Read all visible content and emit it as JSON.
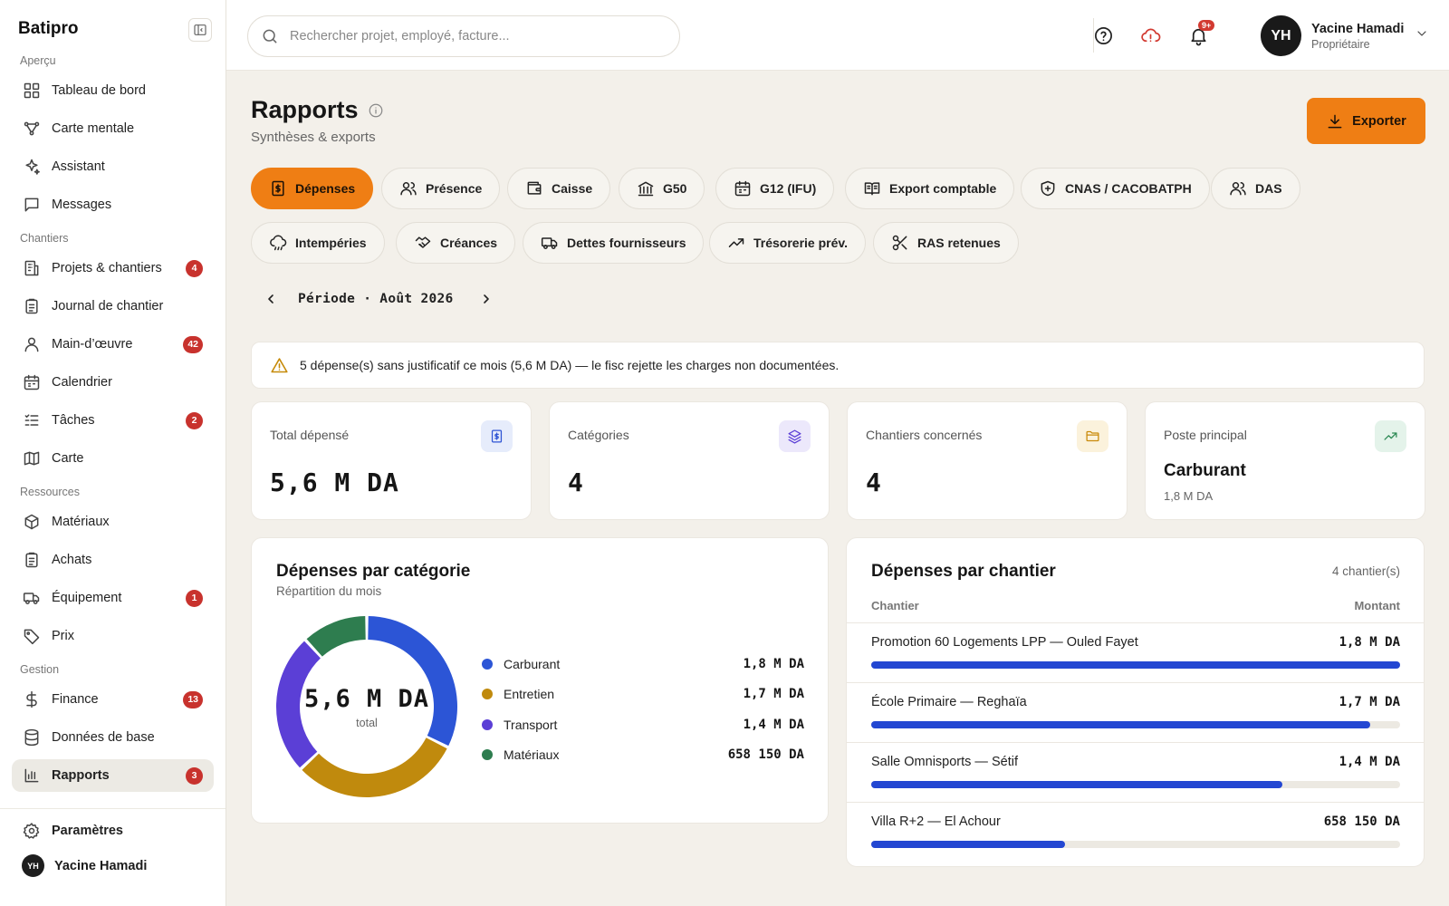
{
  "app": {
    "brand": "Batipro"
  },
  "sidebar": {
    "sections": [
      {
        "title": "Aperçu",
        "items": [
          {
            "label": "Tableau de bord",
            "icon": "dashboard-icon"
          },
          {
            "label": "Carte mentale",
            "icon": "mindmap-icon"
          },
          {
            "label": "Assistant",
            "icon": "sparkles-icon"
          },
          {
            "label": "Messages",
            "icon": "message-icon"
          }
        ]
      },
      {
        "title": "Chantiers",
        "items": [
          {
            "label": "Projets & chantiers",
            "icon": "building-icon",
            "badge": "4"
          },
          {
            "label": "Journal de chantier",
            "icon": "clipboard-icon"
          },
          {
            "label": "Main-d’œuvre",
            "icon": "user-icon",
            "badge": "42"
          },
          {
            "label": "Calendrier",
            "icon": "calendar-icon"
          },
          {
            "label": "Tâches",
            "icon": "tasks-icon",
            "badge": "2"
          },
          {
            "label": "Carte",
            "icon": "map-icon"
          }
        ]
      },
      {
        "title": "Ressources",
        "items": [
          {
            "label": "Matériaux",
            "icon": "package-icon"
          },
          {
            "label": "Achats",
            "icon": "clipboard-icon"
          },
          {
            "label": "Équipement",
            "icon": "truck-icon",
            "badge": "1"
          },
          {
            "label": "Prix",
            "icon": "tag-icon"
          }
        ]
      },
      {
        "title": "Gestion",
        "items": [
          {
            "label": "Finance",
            "icon": "dollar-icon",
            "badge": "13"
          },
          {
            "label": "Données de base",
            "icon": "database-icon"
          },
          {
            "label": "Rapports",
            "icon": "bar-chart-icon",
            "badge": "3",
            "active": true
          }
        ]
      }
    ],
    "settings_label": "Paramètres",
    "user": {
      "initials": "YH",
      "name": "Yacine Hamadi"
    }
  },
  "topbar": {
    "search_placeholder": "Rechercher projet, employé, facture...",
    "notif_badge": "9+",
    "user": {
      "initials": "YH",
      "name": "Yacine Hamadi",
      "role": "Propriétaire"
    }
  },
  "page": {
    "title": "Rapports",
    "subtitle": "Synthèses & exports",
    "export_label": "Exporter",
    "tabs": [
      {
        "label": "Dépenses",
        "icon": "receipt-icon",
        "active": true
      },
      {
        "label": "Présence",
        "icon": "users-icon"
      },
      {
        "label": "Caisse",
        "icon": "wallet-icon"
      },
      {
        "label": "G50",
        "icon": "bank-icon"
      },
      {
        "label": "G12 (IFU)",
        "icon": "calendar-icon"
      },
      {
        "label": "Export comptable",
        "icon": "book-icon"
      },
      {
        "label": "CNAS / CACOBATPH",
        "icon": "shield-icon"
      },
      {
        "label": "DAS",
        "icon": "users-icon"
      },
      {
        "label": "Intempéries",
        "icon": "cloud-rain-icon"
      },
      {
        "label": "Créances",
        "icon": "handshake-icon"
      },
      {
        "label": "Dettes fournisseurs",
        "icon": "truck-icon"
      },
      {
        "label": "Trésorerie prév.",
        "icon": "trend-icon"
      },
      {
        "label": "RAS retenues",
        "icon": "scissors-icon"
      }
    ],
    "period_label": "Période · Août 2026",
    "alert": "5 dépense(s) sans justificatif ce mois (5,6 M DA) — le fisc rejette les charges non documentées.",
    "kpis": [
      {
        "label": "Total dépensé",
        "value": "5,6 M DA",
        "icon": "receipt-icon",
        "icon_color": "#2f55d4",
        "icon_bg": "#e6ecfb"
      },
      {
        "label": "Catégories",
        "value": "4",
        "icon": "layers-icon",
        "icon_color": "#5b3fd6",
        "icon_bg": "#ece8fb"
      },
      {
        "label": "Chantiers concernés",
        "value": "4",
        "icon": "folder-icon",
        "icon_color": "#c98a0a",
        "icon_bg": "#fbf2dc"
      },
      {
        "label": "Poste principal",
        "value": "Carburant",
        "sub": "1,8 M DA",
        "icon": "trending-up-icon",
        "icon_color": "#2e8a55",
        "icon_bg": "#e4f3ea"
      }
    ],
    "category_card": {
      "title": "Dépenses par catégorie",
      "subtitle": "Répartition du mois",
      "center_value": "5,6 M DA",
      "center_label": "total"
    },
    "site_card": {
      "title": "Dépenses par chantier",
      "count": "4 chantier(s)",
      "col_site": "Chantier",
      "col_amount": "Montant"
    }
  },
  "chart_data": [
    {
      "type": "pie",
      "title": "Dépenses par catégorie",
      "subtitle": "Répartition du mois",
      "unit": "DA",
      "categories": [
        "Carburant",
        "Entretien",
        "Transport",
        "Matériaux"
      ],
      "values": [
        1800000,
        1700000,
        1400000,
        658150
      ],
      "labels": [
        "1,8 M DA",
        "1,7 M DA",
        "1,4 M DA",
        "658 150 DA"
      ],
      "colors": [
        "#2c55d6",
        "#c08a0d",
        "#5b3fd6",
        "#2e7d4f"
      ],
      "center_text": "5,6 M DA",
      "legend": "right"
    },
    {
      "type": "bar",
      "title": "Dépenses par chantier",
      "orientation": "horizontal",
      "unit": "DA",
      "categories": [
        "Promotion 60 Logements LPP — Ouled Fayet",
        "École Primaire — Reghaïa",
        "Salle Omnisports — Sétif",
        "Villa R+2 — El Achour"
      ],
      "values": [
        1800000,
        1700000,
        1400000,
        658150
      ],
      "labels": [
        "1,8 M DA",
        "1,7 M DA",
        "1,4 M DA",
        "658 150 DA"
      ],
      "color": "#2347d2"
    }
  ]
}
